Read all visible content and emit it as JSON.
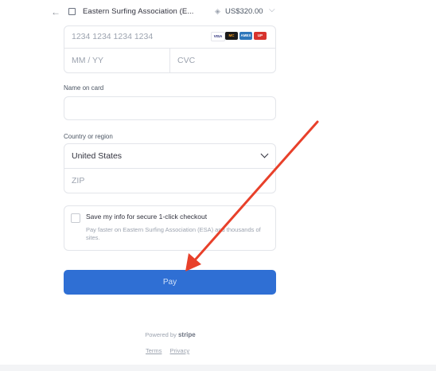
{
  "topbar": {
    "back_icon": "arrow-left-icon",
    "store_icon": "store-icon",
    "store_name": "Eastern Surfing Association (E...",
    "amount": "US$320.00"
  },
  "card": {
    "number_placeholder": "1234 1234 1234 1234",
    "brands": [
      "VISA",
      "MC",
      "AMEX",
      "UP"
    ],
    "expiry_placeholder": "MM / YY",
    "cvc_placeholder": "CVC"
  },
  "name": {
    "label": "Name on card",
    "value": ""
  },
  "country": {
    "label": "Country or region",
    "selected": "United States",
    "zip_placeholder": "ZIP"
  },
  "save": {
    "title": "Save my info for secure 1-click checkout",
    "description": "Pay faster on Eastern Surfing Association (ESA) and thousands of sites."
  },
  "pay_button": {
    "label": "Pay"
  },
  "footer": {
    "powered_prefix": "Powered by",
    "powered_brand": "stripe",
    "terms": "Terms",
    "privacy": "Privacy"
  },
  "colors": {
    "accent": "#2f6fd4",
    "annotation_arrow": "#e8402a"
  }
}
